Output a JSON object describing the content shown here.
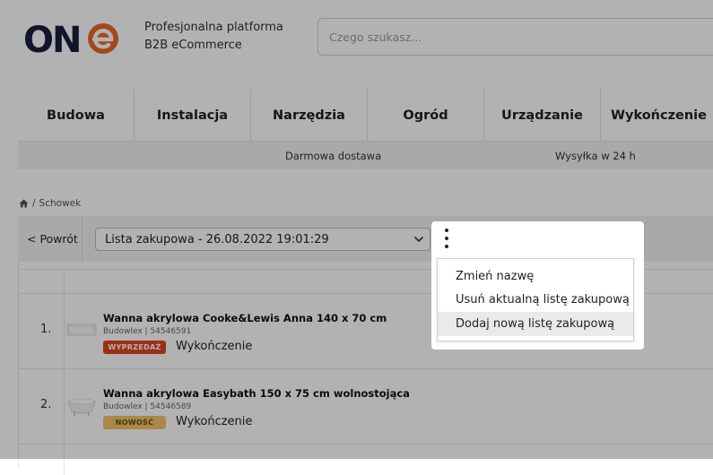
{
  "header": {
    "brand": "ONE",
    "tagline_line1": "Profesjonalna platforma",
    "tagline_line2": "B2B eCommerce",
    "search_placeholder": "Czego szukasz..."
  },
  "nav": {
    "items": [
      {
        "label": "Budowa"
      },
      {
        "label": "Instalacja"
      },
      {
        "label": "Narzędzia"
      },
      {
        "label": "Ogród"
      },
      {
        "label": "Urządzanie"
      },
      {
        "label": "Wykończenie"
      }
    ],
    "info": {
      "shipping_free": "Darmowa dostawa",
      "shipping_time": "Wysyłka w 24 h"
    }
  },
  "breadcrumb": {
    "current": "Schowek",
    "separator": "/"
  },
  "toolbar": {
    "back_label": "< Powrót",
    "list_selected": "Lista zakupowa - 26.08.2022 19:01:29"
  },
  "products": [
    {
      "index": "1.",
      "name": "Wanna akrylowa Cooke&Lewis Anna 140 x 70 cm",
      "meta": "Budowlex | 54546591",
      "badge": "WYPRZEDAŻ",
      "badge_color": "#e0461f",
      "category": "Wykończenie"
    },
    {
      "index": "2.",
      "name": "Wanna akrylowa Easybath 150 x 75 cm wolnostojąca",
      "meta": "Budowlex | 54546589",
      "badge": "NOWOŚĆ",
      "badge_color": "#f2c36b",
      "category": "Wykończenie"
    }
  ],
  "menu": {
    "items": [
      {
        "label": "Zmień nazwę"
      },
      {
        "label": "Usuń aktualną listę zakupową"
      },
      {
        "label": "Dodaj nową listę zakupową"
      }
    ]
  },
  "colors": {
    "brand_dark": "#1a1e3f",
    "brand_accent": "#e8682a",
    "overlay": "rgba(0,0,0,0.30)"
  }
}
